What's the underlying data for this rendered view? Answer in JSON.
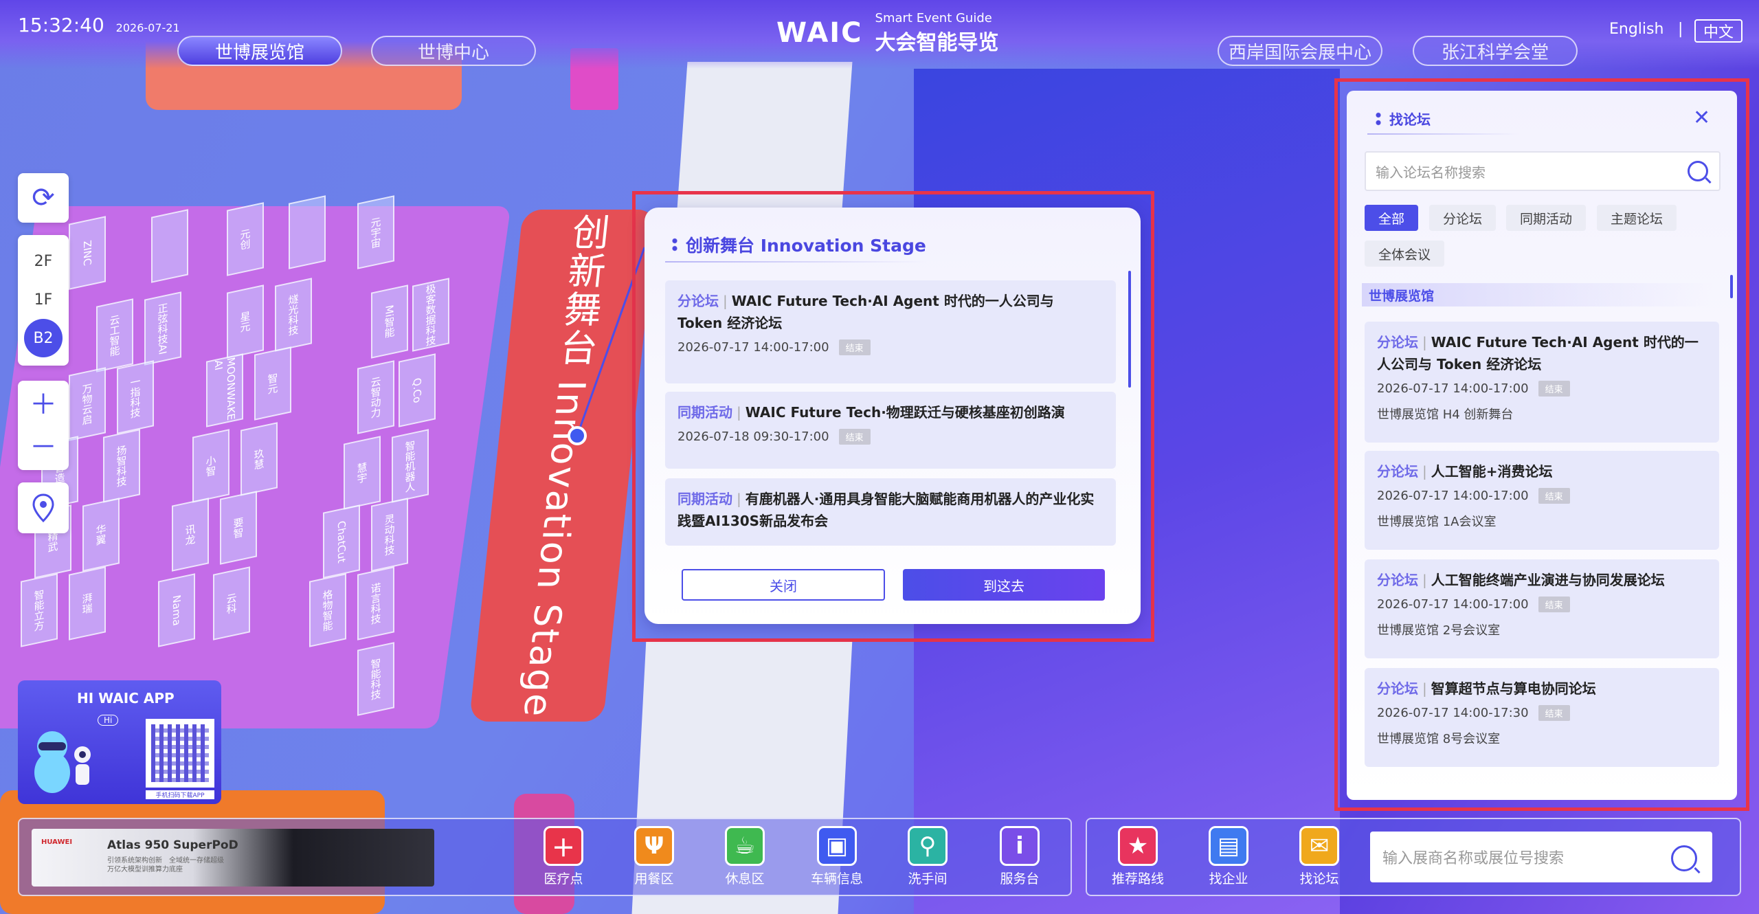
{
  "header": {
    "time": "15:32:40",
    "date": "2026-07-21",
    "venue_tabs": [
      "世博展览馆",
      "世博中心",
      "西岸国际会展中心",
      "张江科学会堂"
    ],
    "active_venue": "世博展览馆",
    "logo_mark": "WAIC",
    "logo_subtitle": "Smart Event Guide",
    "logo_title": "大会智能导览",
    "lang_en": "English",
    "lang_sep": "|",
    "lang_cn": "中文"
  },
  "floors": [
    "2F",
    "1F",
    "B2"
  ],
  "active_floor": "B2",
  "map": {
    "stage_label": "创新舞台 Innovation Stage"
  },
  "app_card": {
    "title": "HI WAIC APP",
    "mascot_bubble": "Hi",
    "qr_caption": "手机扫码下载APP"
  },
  "stage_popup": {
    "title": "创新舞台 Innovation Stage",
    "events": [
      {
        "type": "分论坛",
        "name": "WAIC Future Tech·AI Agent 时代的一人公司与 Token 经济论坛",
        "time": "2026-07-17 14:00-17:00",
        "status": "结束"
      },
      {
        "type": "同期活动",
        "name": "WAIC Future Tech·物理跃迁与硬核基座初创路演",
        "time": "2026-07-18 09:30-17:00",
        "status": "结束"
      },
      {
        "type": "同期活动",
        "name": "有鹿机器人·通用具身智能大脑赋能商用机器人的产业化实践暨AI130S新品发布会",
        "time": "",
        "status": ""
      }
    ],
    "close_label": "关闭",
    "go_label": "到这去"
  },
  "forum_panel": {
    "title": "找论坛",
    "search_placeholder": "输入论坛名称搜索",
    "filters": [
      "全部",
      "分论坛",
      "同期活动",
      "主题论坛",
      "全体会议"
    ],
    "active_filter": "全部",
    "section": "世博展览馆",
    "items": [
      {
        "type": "分论坛",
        "name": "WAIC Future Tech·AI Agent 时代的一人公司与 Token 经济论坛",
        "time": "2026-07-17 14:00-17:00",
        "status": "结束",
        "location": "世博展览馆 H4 创新舞台"
      },
      {
        "type": "分论坛",
        "name": "人工智能+消费论坛",
        "time": "2026-07-17 14:00-17:00",
        "status": "结束",
        "location": "世博展览馆 1A会议室"
      },
      {
        "type": "分论坛",
        "name": "人工智能终端产业演进与协同发展论坛",
        "time": "2026-07-17 14:00-17:00",
        "status": "结束",
        "location": "世博展览馆 2号会议室"
      },
      {
        "type": "分论坛",
        "name": "智算超节点与算电协同论坛",
        "time": "2026-07-17 14:00-17:30",
        "status": "结束",
        "location": "世博展览馆 8号会议室"
      }
    ]
  },
  "bottom_bar": {
    "ad": {
      "brand": "HUAWEI",
      "title": "Atlas 950 SuperPoD",
      "lines": [
        "引领系统架构创新　全域统一存储超级",
        "万亿大模型训推算力底座"
      ]
    },
    "services": [
      {
        "label": "医疗点",
        "icon": "medical-icon",
        "color": "#e8344a"
      },
      {
        "label": "用餐区",
        "icon": "dining-icon",
        "color": "#f08a1c"
      },
      {
        "label": "休息区",
        "icon": "coffee-icon",
        "color": "#3fb950"
      },
      {
        "label": "车辆信息",
        "icon": "bus-icon",
        "color": "#3f5af0"
      },
      {
        "label": "洗手间",
        "icon": "restroom-icon",
        "color": "#2bb3a3"
      },
      {
        "label": "服务台",
        "icon": "info-icon",
        "color": "#7a4ee8"
      }
    ],
    "tools": [
      {
        "label": "推荐路线",
        "icon": "route-icon",
        "color": "#e8345e"
      },
      {
        "label": "找企业",
        "icon": "building-icon",
        "color": "#3f7af0"
      },
      {
        "label": "找论坛",
        "icon": "chat-icon",
        "color": "#f0a81c"
      }
    ],
    "search_placeholder": "输入展商名称或展位号搜索"
  }
}
